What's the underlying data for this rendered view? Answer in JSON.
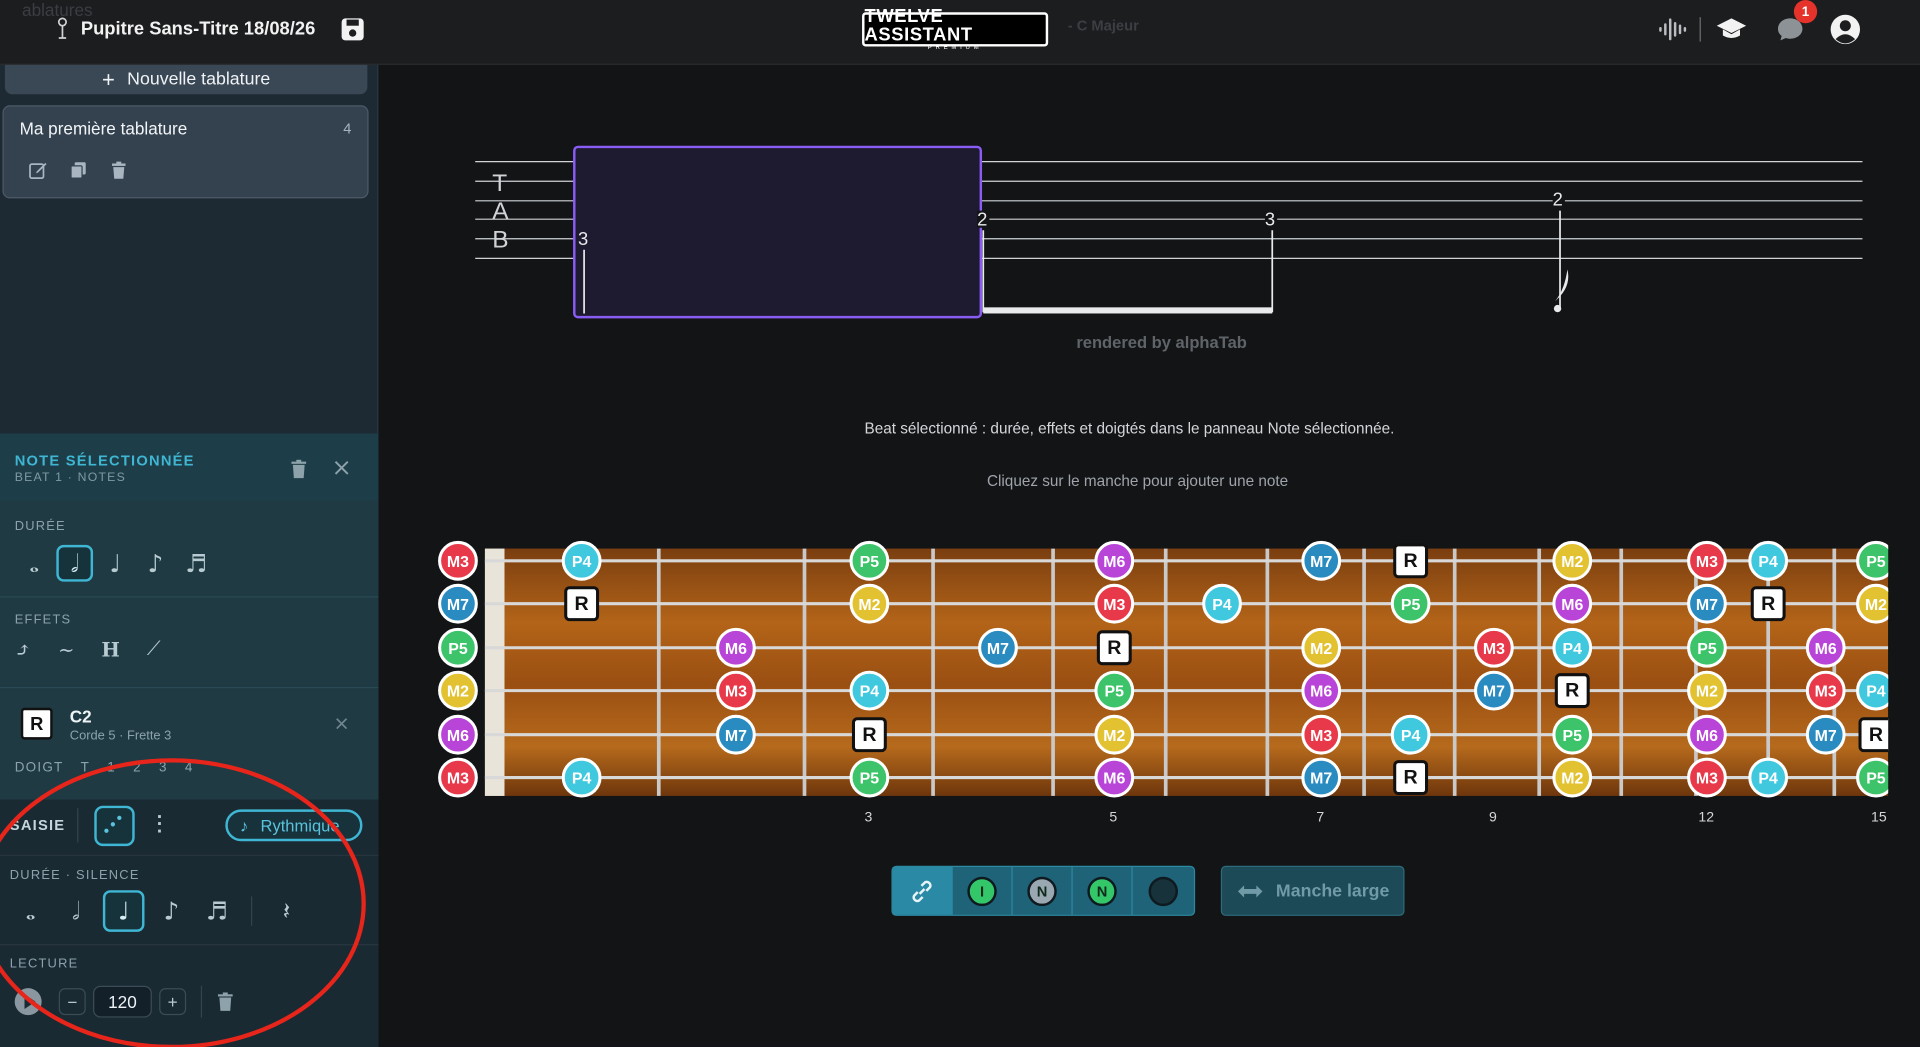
{
  "header": {
    "ghost_label": "ablatures",
    "title": "Pupitre Sans-Titre 18/08/26",
    "logo_main": "TWELVE ASSISTANT",
    "logo_sub": "PREMIUM",
    "key_ghost": "- C Majeur",
    "notification_count": "1"
  },
  "sidebar": {
    "new_tab_label": "Nouvelle tablature",
    "tabs": [
      {
        "name": "Ma première tablature",
        "count": "4"
      }
    ]
  },
  "note_panel": {
    "title": "NOTE SÉLECTIONNÉE",
    "subtitle": "BEAT 1 · NOTES",
    "duration_label": "DURÉE",
    "effects_label": "EFFETS",
    "durations": [
      "𝅝",
      "𝅗𝅥",
      "♩",
      "♪",
      "♬"
    ],
    "active_duration": 1,
    "effects": [
      "⤴",
      "∼",
      "H",
      "⟋"
    ],
    "selected": {
      "badge": "R",
      "name": "C2",
      "position": "Corde 5 · Frette 3"
    },
    "fingering_label": "DOIGT",
    "fingers": [
      "T",
      "1",
      "2",
      "3",
      "4"
    ]
  },
  "saisie": {
    "label": "SAISIE",
    "rhythm_label": "Rythmique",
    "duration_label": "DURÉE · SILENCE",
    "durations": [
      "𝅝",
      "𝅗𝅥",
      "♩",
      "♪",
      "♬"
    ],
    "active_duration": 2,
    "rest_symbol": "𝄽",
    "lecture_label": "LECTURE",
    "minus": "−",
    "plus": "+",
    "tempo": "120"
  },
  "score": {
    "tab_letters": [
      "T",
      "A",
      "B"
    ],
    "notes": [
      "3",
      "2",
      "3",
      "2"
    ],
    "rendered_by": "rendered by alphaTab"
  },
  "hints": {
    "beat": "Beat sélectionné : durée, effets et doigtés dans le panneau Note sélectionnée.",
    "click": "Cliquez sur le manche pour ajouter une note"
  },
  "fretboard": {
    "fret_numbers": [
      "3",
      "5",
      "7",
      "9",
      "12",
      "15"
    ],
    "string_labels": [
      "M3",
      "M7",
      "P5",
      "M2",
      "M6",
      "M3"
    ]
  },
  "toolbar": {
    "buttons": [
      "link",
      "I",
      "N",
      "N",
      "circle"
    ],
    "large_label": "Manche large"
  },
  "colors": {
    "accent": "#3fb6d3",
    "selection": "#8a5cf6",
    "annotation": "#e8251b"
  }
}
